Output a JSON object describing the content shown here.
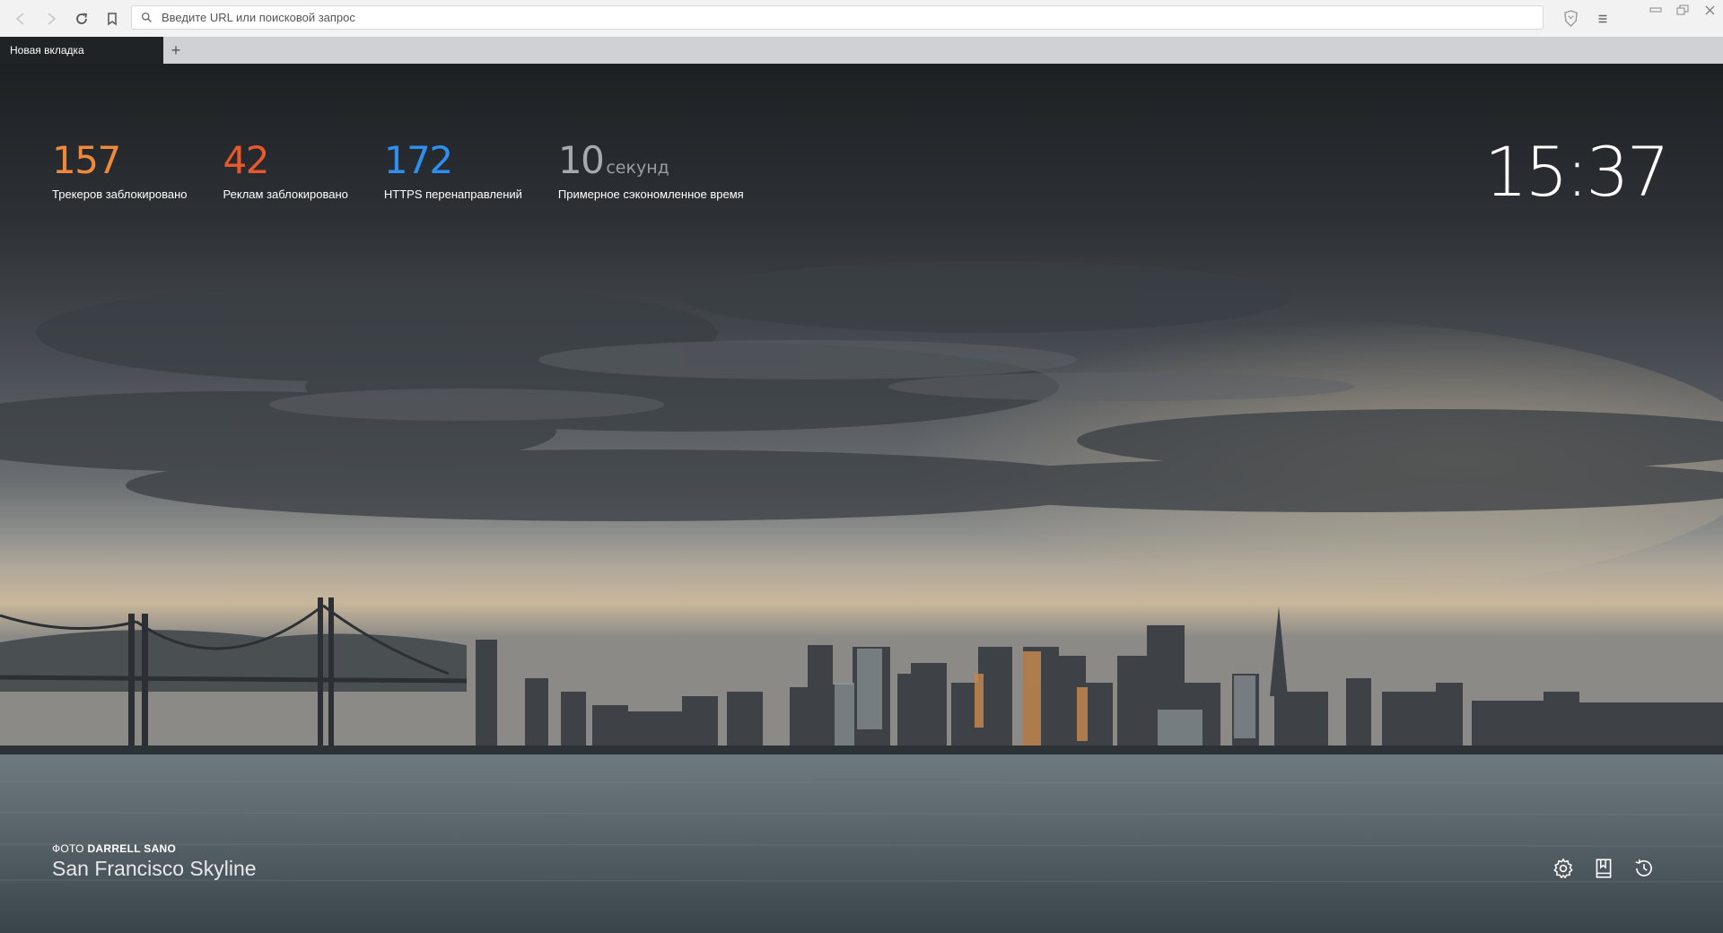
{
  "browser": {
    "url_placeholder": "Введите URL или поисковой запрос",
    "tab_title": "Новая вкладка",
    "new_tab_symbol": "+"
  },
  "stats": [
    {
      "value": "157",
      "unit": "",
      "label": "Трекеров заблокировано",
      "color": "#f0883b"
    },
    {
      "value": "42",
      "unit": "",
      "label": "Реклам заблокировано",
      "color": "#e9582c"
    },
    {
      "value": "172",
      "unit": "",
      "label": "HTTPS перенаправлений",
      "color": "#2f8ff0"
    },
    {
      "value": "10",
      "unit": "секунд",
      "label": "Примерное сэкономленное время",
      "color": "#a6a9ad"
    }
  ],
  "clock": "15:37",
  "photo": {
    "prefix": "ФОТО",
    "author": "DARRELL SANO",
    "title": "San Francisco Skyline"
  },
  "icons": {
    "back": "back-arrow-icon",
    "forward": "forward-arrow-icon",
    "reload": "reload-icon",
    "bookmark": "bookmark-icon",
    "search": "search-icon",
    "shield": "brave-shield-icon",
    "menu": "menu-icon",
    "settings": "gear-icon",
    "bookmarks": "bookmarks-icon",
    "history": "history-icon"
  },
  "window_controls": [
    "minimize",
    "restore",
    "close"
  ]
}
